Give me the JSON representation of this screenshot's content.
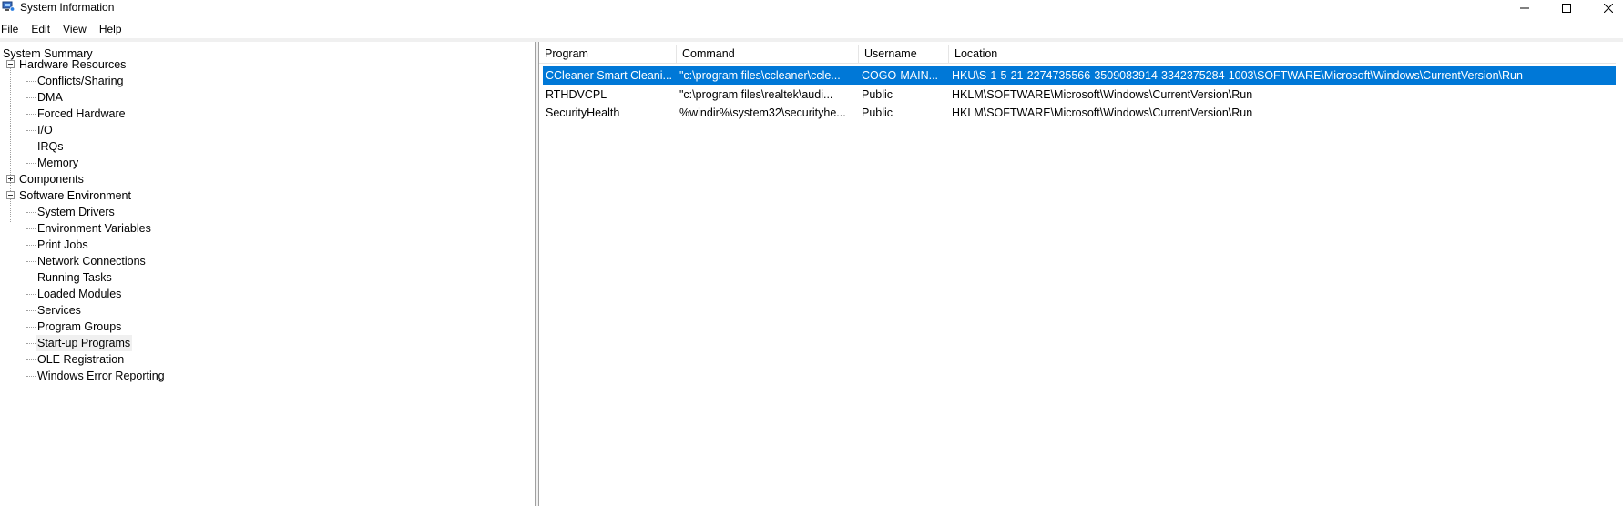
{
  "window": {
    "title": "System Information"
  },
  "menu": [
    "File",
    "Edit",
    "View",
    "Help"
  ],
  "tree": {
    "root": "System Summary",
    "hardware": {
      "label": "Hardware Resources",
      "children": [
        "Conflicts/Sharing",
        "DMA",
        "Forced Hardware",
        "I/O",
        "IRQs",
        "Memory"
      ]
    },
    "components": "Components",
    "software": {
      "label": "Software Environment",
      "children": [
        "System Drivers",
        "Environment Variables",
        "Print Jobs",
        "Network Connections",
        "Running Tasks",
        "Loaded Modules",
        "Services",
        "Program Groups",
        "Start-up Programs",
        "OLE Registration",
        "Windows Error Reporting"
      ]
    },
    "selected": "Start-up Programs"
  },
  "table": {
    "columns": [
      "Program",
      "Command",
      "Username",
      "Location"
    ],
    "rows": [
      [
        "CCleaner Smart Cleani...",
        "\"c:\\program files\\ccleaner\\ccle...",
        "COGO-MAIN...",
        "HKU\\S-1-5-21-2274735566-3509083914-3342375284-1003\\SOFTWARE\\Microsoft\\Windows\\CurrentVersion\\Run"
      ],
      [
        "RTHDVCPL",
        "\"c:\\program files\\realtek\\audi...",
        "Public",
        "HKLM\\SOFTWARE\\Microsoft\\Windows\\CurrentVersion\\Run"
      ],
      [
        "SecurityHealth",
        "%windir%\\system32\\securityhe...",
        "Public",
        "HKLM\\SOFTWARE\\Microsoft\\Windows\\CurrentVersion\\Run"
      ]
    ],
    "selected_row": 0
  },
  "colors": {
    "selection": "#0078d7",
    "tree_selection": "#f0f0f0"
  }
}
